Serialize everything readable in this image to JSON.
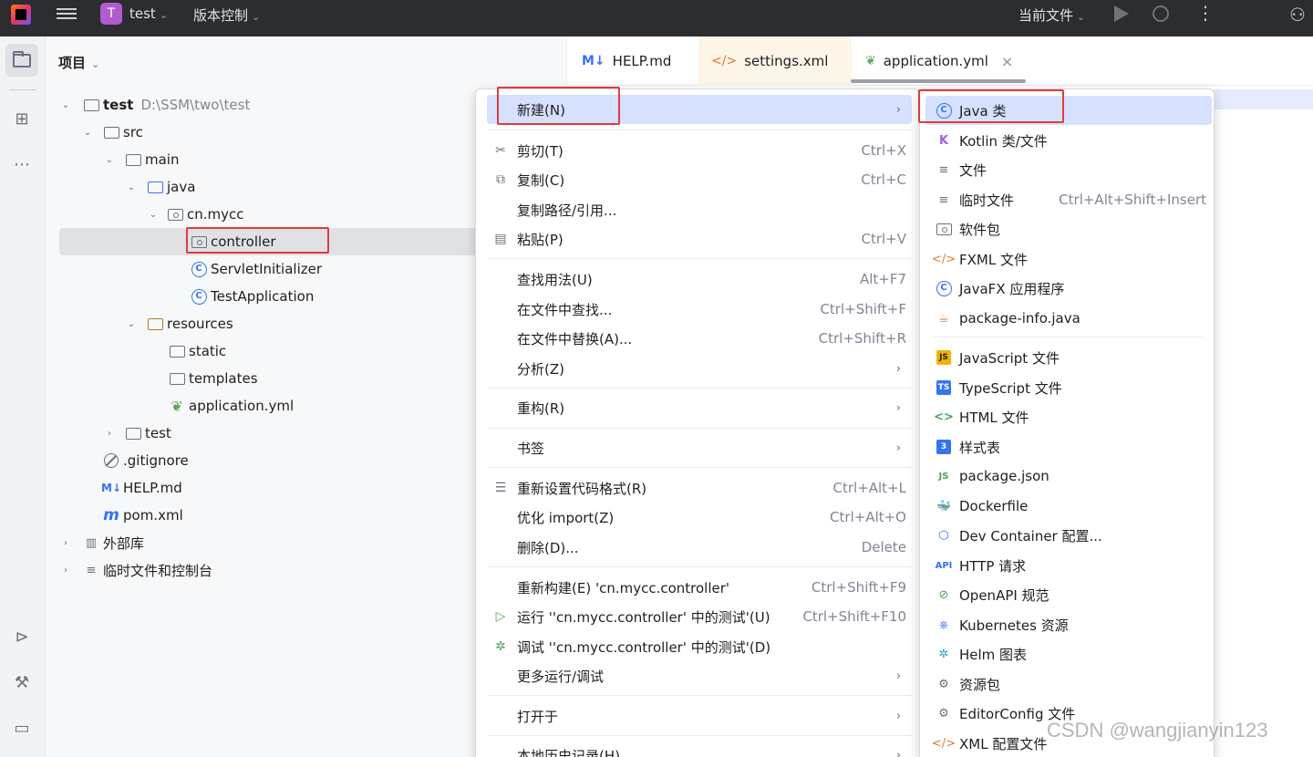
{
  "titlebar": {
    "project_badge": "T",
    "project_name": "test",
    "vcs_label": "版本控制",
    "current_file": "当前文件"
  },
  "project_panel": {
    "title": "项目",
    "tree": [
      {
        "label": "test",
        "path": "D:\\SSM\\two\\test"
      },
      {
        "label": "src"
      },
      {
        "label": "main"
      },
      {
        "label": "java"
      },
      {
        "label": "cn.mycc"
      },
      {
        "label": "controller"
      },
      {
        "label": "ServletInitializer"
      },
      {
        "label": "TestApplication"
      },
      {
        "label": "resources"
      },
      {
        "label": "static"
      },
      {
        "label": "templates"
      },
      {
        "label": "application.yml"
      },
      {
        "label": "test"
      },
      {
        "label": ".gitignore"
      },
      {
        "label": "HELP.md"
      },
      {
        "label": "pom.xml"
      },
      {
        "label": "外部库"
      },
      {
        "label": "临时文件和控制台"
      }
    ]
  },
  "tabs": [
    {
      "label": "HELP.md",
      "icon": "M↓"
    },
    {
      "label": "settings.xml",
      "icon": "</>"
    },
    {
      "label": "application.yml",
      "icon": "yml"
    }
  ],
  "context_menu": {
    "items": [
      {
        "label": "新建(N)"
      },
      {
        "label": "剪切(T)",
        "shortcut": "Ctrl+X"
      },
      {
        "label": "复制(C)",
        "shortcut": "Ctrl+C"
      },
      {
        "label": "复制路径/引用..."
      },
      {
        "label": "粘贴(P)",
        "shortcut": "Ctrl+V"
      },
      {
        "label": "查找用法(U)",
        "shortcut": "Alt+F7"
      },
      {
        "label": "在文件中查找...",
        "shortcut": "Ctrl+Shift+F"
      },
      {
        "label": "在文件中替换(A)...",
        "shortcut": "Ctrl+Shift+R"
      },
      {
        "label": "分析(Z)"
      },
      {
        "label": "重构(R)"
      },
      {
        "label": "书签"
      },
      {
        "label": "重新设置代码格式(R)",
        "shortcut": "Ctrl+Alt+L"
      },
      {
        "label": "优化 import(Z)",
        "shortcut": "Ctrl+Alt+O"
      },
      {
        "label": "删除(D)...",
        "shortcut": "Delete"
      },
      {
        "label": "重新构建(E) 'cn.mycc.controller'",
        "shortcut": "Ctrl+Shift+F9"
      },
      {
        "label": "运行 ''cn.mycc.controller' 中的测试'(U)",
        "shortcut": "Ctrl+Shift+F10"
      },
      {
        "label": "调试 ''cn.mycc.controller' 中的测试'(D)"
      },
      {
        "label": "更多运行/调试"
      },
      {
        "label": "打开于"
      },
      {
        "label": "本地历史记录(H)"
      }
    ]
  },
  "new_submenu": {
    "items": [
      {
        "label": "Java 类",
        "icon": "C"
      },
      {
        "label": "Kotlin 类/文件",
        "icon": "K"
      },
      {
        "label": "文件",
        "icon": "≡"
      },
      {
        "label": "临时文件",
        "shortcut": "Ctrl+Alt+Shift+Insert",
        "icon": "≡"
      },
      {
        "label": "软件包",
        "icon": "pkg"
      },
      {
        "label": "FXML 文件",
        "icon": "</>"
      },
      {
        "label": "JavaFX 应用程序",
        "icon": "C"
      },
      {
        "label": "package-info.java",
        "icon": "☕"
      },
      {
        "label": "JavaScript 文件",
        "icon": "JS"
      },
      {
        "label": "TypeScript 文件",
        "icon": "TS"
      },
      {
        "label": "HTML 文件",
        "icon": "<>"
      },
      {
        "label": "样式表",
        "icon": "3"
      },
      {
        "label": "package.json",
        "icon": "JS"
      },
      {
        "label": "Dockerfile",
        "icon": "🐳"
      },
      {
        "label": "Dev Container 配置...",
        "icon": "⬡"
      },
      {
        "label": "HTTP 请求",
        "icon": "API"
      },
      {
        "label": "OpenAPI 规范",
        "icon": "⊘"
      },
      {
        "label": "Kubernetes 资源",
        "icon": "⎈"
      },
      {
        "label": "Helm 图表",
        "icon": "✲"
      },
      {
        "label": "资源包",
        "icon": "⚙"
      },
      {
        "label": "EditorConfig 文件",
        "icon": "⚙"
      },
      {
        "label": "XML 配置文件",
        "icon": "</>"
      }
    ]
  },
  "watermark": "CSDN @wangjianyin123",
  "colors": {
    "accent": "#3574f0",
    "highlight": "#e33a3a",
    "selection": "#d5e1ff"
  }
}
